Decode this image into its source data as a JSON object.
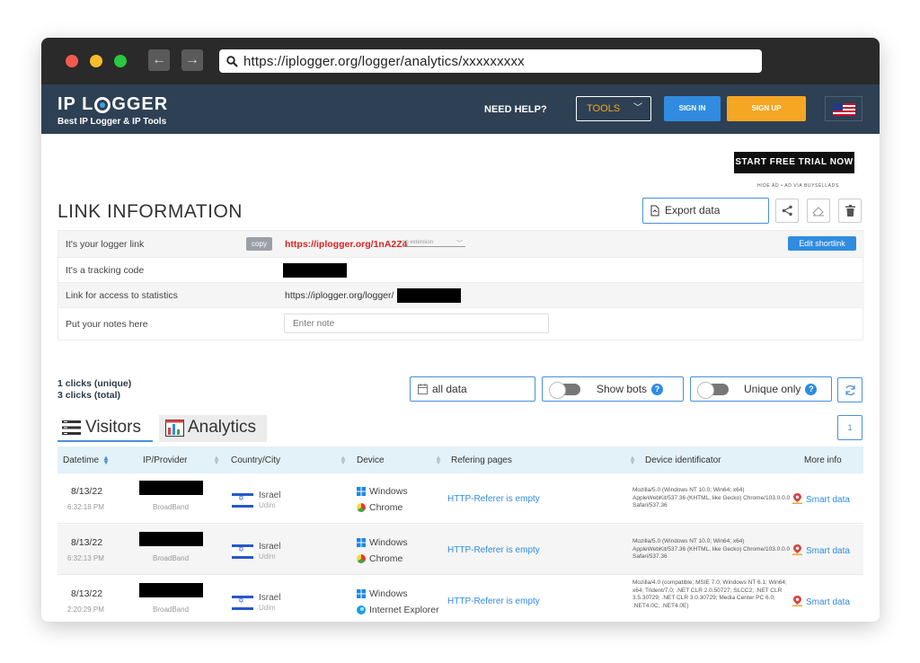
{
  "browser": {
    "url": "https://iplogger.org/logger/analytics/xxxxxxxxx"
  },
  "header": {
    "logo_text_a": "IP L",
    "logo_text_b": "GGER",
    "logo_sub": "Best IP Logger & IP Tools",
    "need_help": "NEED HELP?",
    "tools": "TOOLS",
    "sign_in": "SIGN IN",
    "sign_up": "SIGN UP"
  },
  "ad": {
    "trial": "START FREE TRIAL NOW",
    "hide_ad": "HIDE AD • AD VIA BUYSELLADS"
  },
  "link_info": {
    "title": "LINK INFORMATION",
    "export": "Export data",
    "rows": {
      "logger_label": "It's your logger link",
      "copy": "copy",
      "logger_link": "https://iplogger.org/1nA2Z4",
      "extension": "no extension",
      "edit_shortlink": "Edit shortlink",
      "tracking_label": "It's a tracking code",
      "stats_label": "Link for access to statistics",
      "stats_link": "https://iplogger.org/logger/",
      "notes_label": "Put your notes here",
      "notes_placeholder": "Enter note"
    }
  },
  "stats": {
    "unique": "1 clicks (unique)",
    "total": "3 clicks (total)",
    "date_filter": "all data",
    "show_bots": "Show bots",
    "unique_only": "Unique only",
    "help": "?"
  },
  "tabs": {
    "visitors": "Visitors",
    "analytics": "Analytics",
    "page": "1"
  },
  "table": {
    "headers": {
      "datetime": "Datetime",
      "ip": "IP/Provider",
      "country": "Country/City",
      "device": "Device",
      "refering": "Refering pages",
      "identificator": "Device identificator",
      "more": "More info"
    },
    "rows": [
      {
        "date": "8/13/22",
        "time": "6:32:18 PM",
        "provider": "BroadBand",
        "country": "Israel",
        "city": "Udim",
        "os": "Windows",
        "browser": "Chrome",
        "referer": "HTTP-Referer is empty",
        "ua": "Mozilla/5.0 (Windows NT 10.0; Win64; x64) AppleWebKit/537.36 (KHTML, like Gecko) Chrome/103.0.0.0 Safari/537.36",
        "more": "Smart data"
      },
      {
        "date": "8/13/22",
        "time": "6:32:13 PM",
        "provider": "BroadBand",
        "country": "Israel",
        "city": "Udim",
        "os": "Windows",
        "browser": "Chrome",
        "referer": "HTTP-Referer is empty",
        "ua": "Mozilla/5.0 (Windows NT 10.0; Win64; x64) AppleWebKit/537.36 (KHTML, like Gecko) Chrome/103.0.0.0 Safari/537.36",
        "more": "Smart data"
      },
      {
        "date": "8/13/22",
        "time": "2:20:29 PM",
        "provider": "BroadBand",
        "country": "Israel",
        "city": "Udim",
        "os": "Windows",
        "browser": "Internet Explorer",
        "referer": "HTTP-Referer is empty",
        "ua": "Mozilla/4.0 (compatible; MSIE 7.0; Windows NT 6.1; Win64; x64; Trident/7.0; .NET CLR 2.0.50727; SLCC2; .NET CLR 3.5.30729; .NET CLR 3.0.30729; Media Center PC 6.0; .NET4.0C; .NET4.0E)",
        "more": "Smart data"
      }
    ]
  },
  "colors": {
    "header_bg": "#2e4054",
    "accent": "#2f8ce0",
    "orange": "#f5a623",
    "link_red": "#e01f1f"
  }
}
